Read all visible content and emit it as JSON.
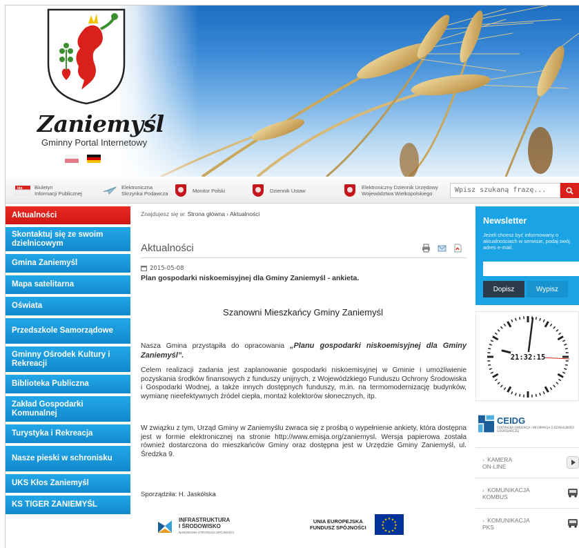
{
  "header": {
    "brand_title": "Zaniemyśl",
    "brand_subtitle": "Gminny Portal Internetowy",
    "languages": [
      "polish-flag",
      "german-flag"
    ]
  },
  "toplinks": [
    {
      "label": "Biuletyn\nInformacji Publicznej",
      "icon": "bip-icon"
    },
    {
      "label": "Elektroniczna\nSkrzynka Podawcza",
      "icon": "epuap-icon"
    },
    {
      "label": "Monitor Polski",
      "icon": "emblem-icon"
    },
    {
      "label": "Dziennik Ustaw",
      "icon": "emblem-icon"
    },
    {
      "label": "Elektroniczny Dziennik Urzędowy\nWojewództwa Wielkopolskiego",
      "icon": "emblem-icon"
    }
  ],
  "search": {
    "placeholder": "Wpisz szukaną frazę..."
  },
  "nav": [
    {
      "label": "Aktualności",
      "active": true
    },
    {
      "label": "Skontaktuj się ze swoim dzielnicowym"
    },
    {
      "label": "Gmina Zaniemyśl"
    },
    {
      "label": "Mapa satelitarna"
    },
    {
      "label": "Oświata"
    },
    {
      "label": "Przedszkole Samorządowe"
    },
    {
      "label": "Gminny Ośrodek Kultury i Rekreacji"
    },
    {
      "label": "Biblioteka Publiczna"
    },
    {
      "label": "Zakład Gospodarki Komunalnej"
    },
    {
      "label": "Turystyka i Rekreacja"
    },
    {
      "label": "Nasze pieski w schronisku"
    },
    {
      "label": "UKS Kłos Zaniemyśl"
    },
    {
      "label": "KS TIGER ZANIEMYŚL"
    }
  ],
  "breadcrumb": {
    "prefix": "Znajdujesz się w:",
    "home": "Strona główna",
    "sep": "›",
    "current": "Aktualności"
  },
  "page_title": "Aktualności",
  "article": {
    "date": "2015-05-08",
    "title": "Plan gospodarki niskoemisyjnej dla Gminy Zaniemyśl - ankieta.",
    "greeting": "Szanowni Mieszkańcy Gminy Zaniemyśl",
    "p1_lead": "Nasza Gmina przystąpiła do opracowania ",
    "p1_emph": "„Planu gospodarki niskoemisyjnej dla Gminy Zaniemyśl”.",
    "p2": "Celem realizacji zadania jest zaplanowanie gospodarki niskoemisyjnej w Gminie i umożliwienie pozyskania środków finansowych z funduszy unijnych, z Wojewódzkiego Funduszu Ochrony Środowiska i Gospodarki Wodnej, a także innych dostępnych funduszy, m.in. na termomodernizację budynków, wymianę nieefektywnych źródeł ciepła, montaż kolektorów słonecznych, itp.",
    "p3": "W związku z tym, Urząd Gminy w Zaniemyślu zwraca się z prośbą o wypełnienie ankiety, która dostępna jest w formie elektronicznej na stronie http://www.emisja.org/zaniemysl. Wersja papierowa została również dostarczona do mieszkańców Gminy oraz dostępna jest w Urzędzie Gminy Zaniemyśl, ul. Średzka 9.",
    "author": "Sporządziła: H. Jaskólska",
    "logo_infra_line1": "INFRASTRUKTURA",
    "logo_infra_line2": "I ŚRODOWISKO",
    "logo_infra_small": "NARODOWA STRATEGIA SPÓJNOŚCI",
    "logo_ue_line1": "UNIA EUROPEJSKA",
    "logo_ue_line2": "FUNDUSZ SPÓJNOŚCI"
  },
  "newsletter": {
    "title": "Newsletter",
    "text": "Jeżeli chcesz być informowany o aktualnościach w serwisie, podaj swój adres e-mail.",
    "subscribe": "Dopisz",
    "unsubscribe": "Wypisz"
  },
  "clock": {
    "time": "21:32:15"
  },
  "ceidg": {
    "name": "CEIDG",
    "desc": "CENTRALNA EWIDENCJA I INFORMACJA O DZIAŁALNOŚCI GOSPODARCZEJ"
  },
  "right_links": [
    {
      "label": "KAMERA\nON-LINE",
      "icon": "play-icon"
    },
    {
      "label": "KOMUNIKACJA\nKOMBUS",
      "icon": "bus-icon"
    },
    {
      "label": "KOMUNIKACJA\nPKS",
      "icon": "bus-icon"
    }
  ],
  "colors": {
    "nav_blue": "#1aa3e5",
    "nav_active_red": "#d9201b",
    "newsletter_bg": "#1aa3e5",
    "search_button": "#d9201b"
  }
}
